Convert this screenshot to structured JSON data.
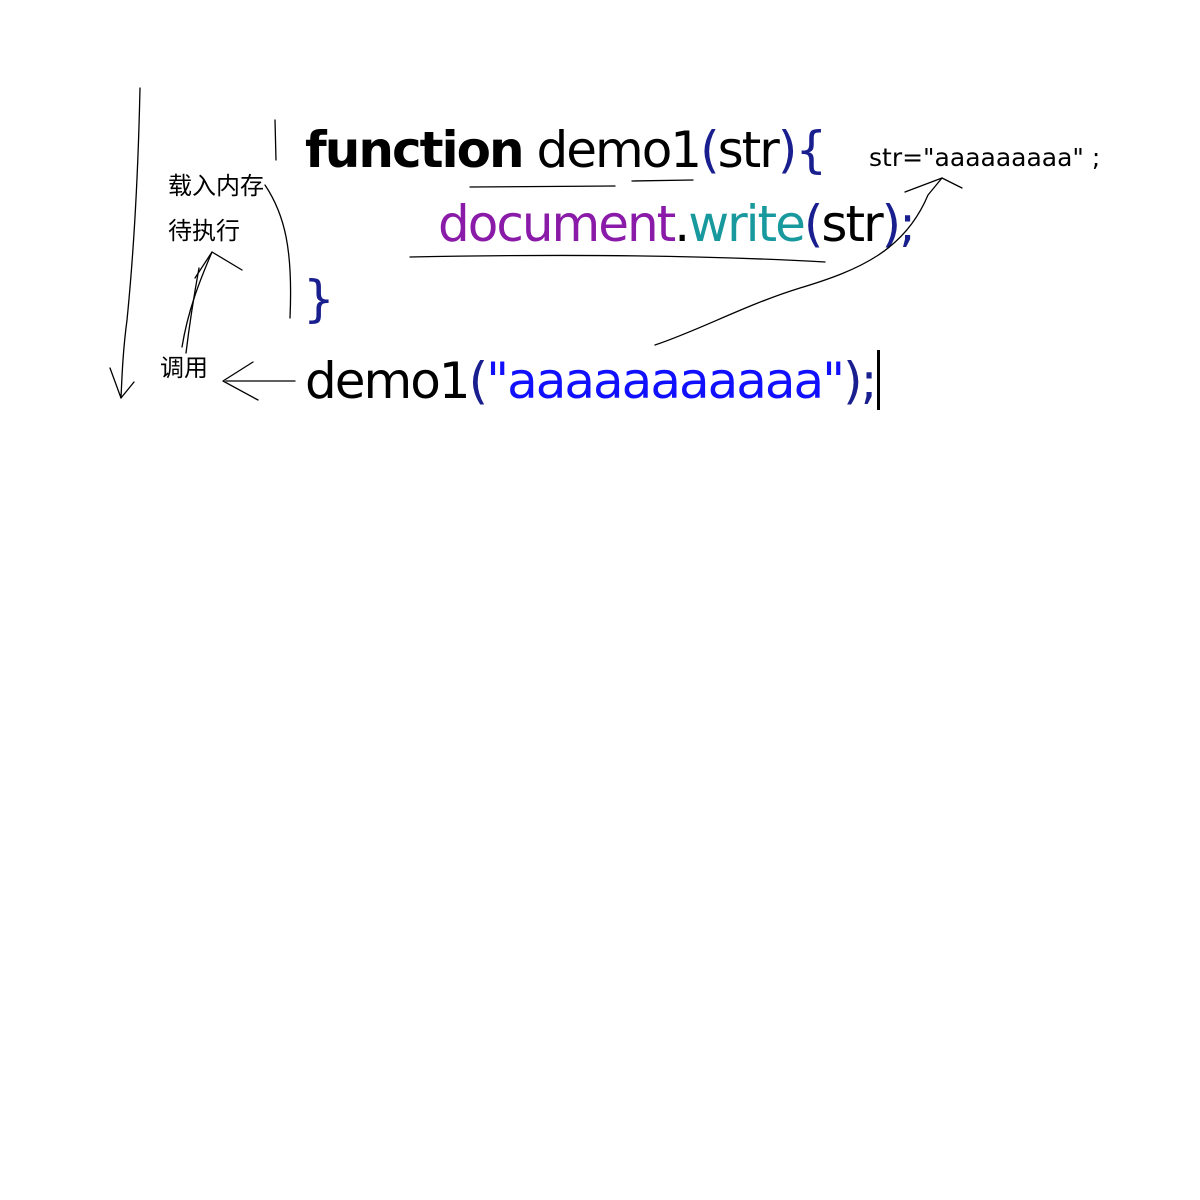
{
  "code": {
    "line1": {
      "keyword": "function",
      "name": "demo1",
      "open_paren": "(",
      "param": "str",
      "close_paren_brace": "){"
    },
    "line2": {
      "object": "document",
      "dot": ".",
      "method": "write",
      "open_paren": "(",
      "arg": "str",
      "close": ");"
    },
    "line3": {
      "brace": "}"
    },
    "line4": {
      "name": "demo1",
      "open_paren": "(",
      "string": "\"aaaaaaaaaaa\"",
      "close": ");"
    }
  },
  "annotations": {
    "load_to_memory": "载入内存",
    "wait_to_execute": "待执行",
    "invoke": "调用",
    "assignment": "str=\"aaaaaaaaa\" ;"
  },
  "colors": {
    "keyword": "#000000",
    "punctuation": "#1a1f8f",
    "object": "#8a1aa8",
    "method": "#18999d",
    "string": "#1010ff",
    "ink": "#000000",
    "background": "#ffffff"
  }
}
